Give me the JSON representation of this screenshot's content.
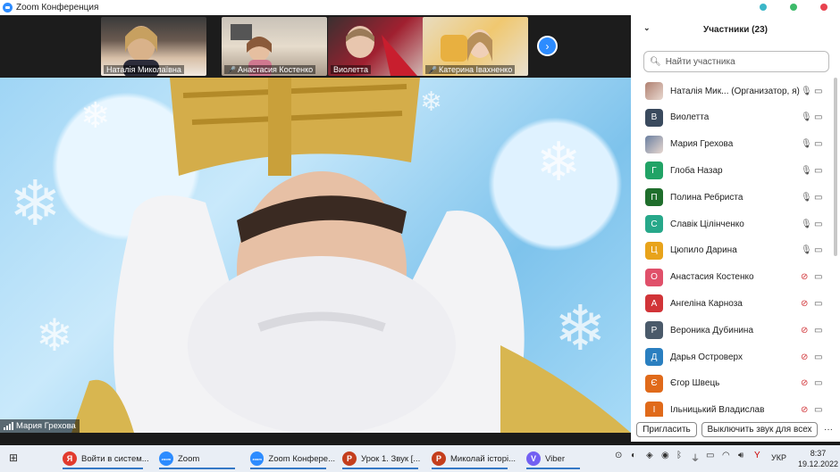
{
  "window": {
    "title": "Zoom Конференция"
  },
  "thumbnails": [
    {
      "name": "Наталія Миколаївна",
      "muted": false
    },
    {
      "name": "Анастасия Костенко",
      "muted": true
    },
    {
      "name": "Виолетта",
      "muted": false
    },
    {
      "name": "Катерина Івахненко",
      "muted": true
    }
  ],
  "main_video": {
    "speaker": "Мария Грехова"
  },
  "participants_panel": {
    "title": "Участники (23)",
    "search_placeholder": "Найти участника",
    "participants": [
      {
        "name": "Наталія Мик... (Организатор, я)",
        "initial": "",
        "avatar_color": "#b08070",
        "mic": "on",
        "photo": true
      },
      {
        "name": "Виолетта",
        "initial": "В",
        "avatar_color": "#3a4a5e",
        "mic": "on",
        "photo": false
      },
      {
        "name": "Мария Грехова",
        "initial": "",
        "avatar_color": "#6a7fa0",
        "mic": "on",
        "photo": true
      },
      {
        "name": "Глоба Назар",
        "initial": "Г",
        "avatar_color": "#21a366",
        "mic": "on",
        "photo": false
      },
      {
        "name": "Полина Ребриста",
        "initial": "П",
        "avatar_color": "#1f6e2c",
        "mic": "on",
        "photo": false
      },
      {
        "name": "Славік Цілінченко",
        "initial": "С",
        "avatar_color": "#27a88a",
        "mic": "on",
        "photo": false
      },
      {
        "name": "Цюпило Дарина",
        "initial": "Ц",
        "avatar_color": "#e8a31b",
        "mic": "on",
        "photo": false
      },
      {
        "name": "Анастасия Костенко",
        "initial": "О",
        "avatar_color": "#e0506a",
        "mic": "off",
        "photo": false
      },
      {
        "name": "Ангеліна Карноза",
        "initial": "А",
        "avatar_color": "#d13438",
        "mic": "off",
        "photo": false
      },
      {
        "name": "Вероника Дубинина",
        "initial": "Р",
        "avatar_color": "#4a5a6a",
        "mic": "off",
        "photo": false
      },
      {
        "name": "Дарья Островерх",
        "initial": "Д",
        "avatar_color": "#2a7fc0",
        "mic": "off",
        "photo": false
      },
      {
        "name": "Єгор Швець",
        "initial": "Є",
        "avatar_color": "#e06a1a",
        "mic": "off",
        "photo": false
      },
      {
        "name": "Ільницький Владислав",
        "initial": "І",
        "avatar_color": "#e06a1a",
        "mic": "off",
        "photo": false
      }
    ],
    "invite_label": "Пригласить",
    "unmute_all_label": "Выключить звук для всех",
    "more_label": "···"
  },
  "taskbar": {
    "items": [
      {
        "label": "Войти в систем...",
        "icon_color": "#e23b2e",
        "icon_text": "Я"
      },
      {
        "label": "Zoom",
        "icon_color": "#2d8cff",
        "icon_text": "zoom"
      },
      {
        "label": "Zoom Конфере...",
        "icon_color": "#2d8cff",
        "icon_text": "zoom"
      },
      {
        "label": "Урок 1. Звук [...",
        "icon_color": "#c43e1c",
        "icon_text": "P"
      },
      {
        "label": "Миколай історі...",
        "icon_color": "#c43e1c",
        "icon_text": "P"
      },
      {
        "label": "Viber",
        "icon_color": "#7360f2",
        "icon_text": "V"
      }
    ],
    "language": "УКР",
    "time": "8:37",
    "date": "19.12.2022"
  }
}
